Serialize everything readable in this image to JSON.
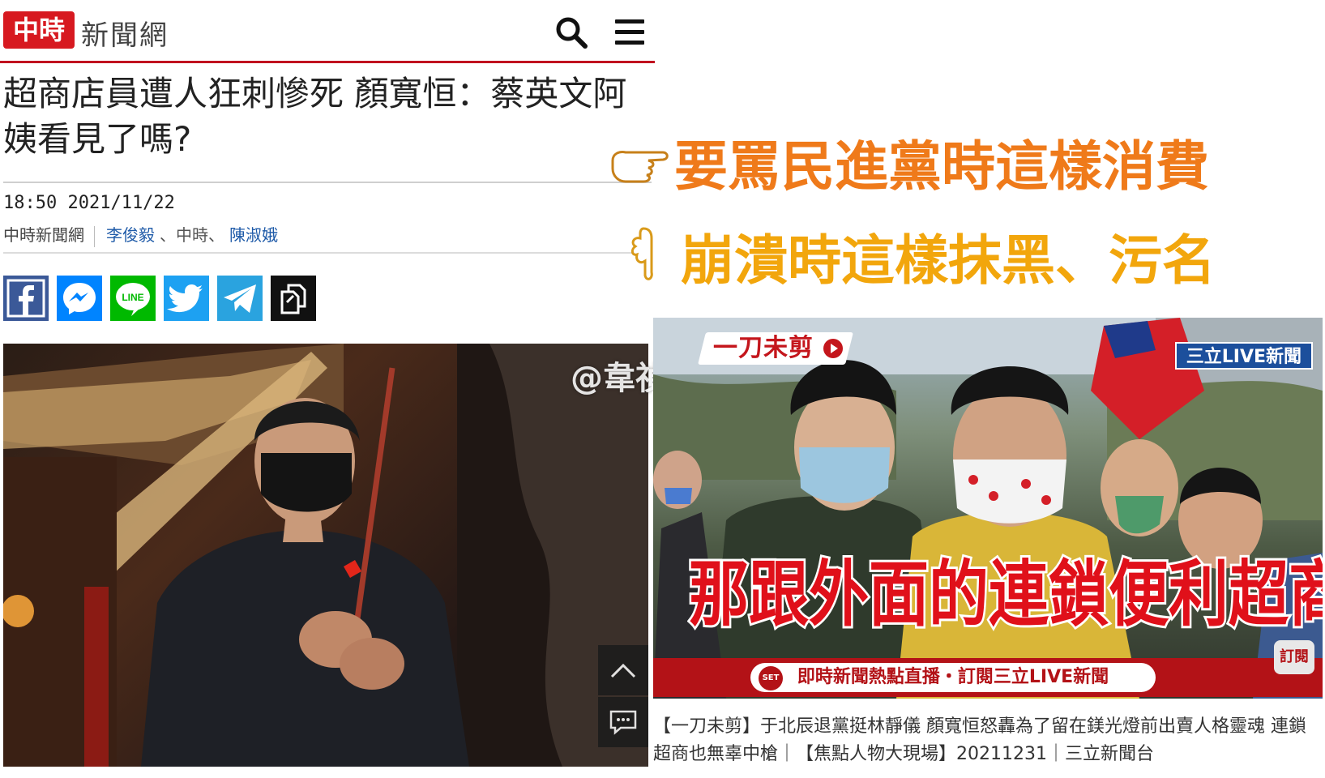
{
  "site": {
    "logo_mark": "中時",
    "logo_text": "新聞網",
    "search_icon": "search-icon",
    "menu_icon": "menu-icon"
  },
  "article": {
    "headline": "超商店員遭人狂刺慘死 顏寬恒：蔡英文阿姨看見了嗎?",
    "datetime": "18:50 2021/11/22",
    "source": "中時新聞網",
    "author1": "李俊毅",
    "sep1": "、中時、",
    "author2": "陳淑娥"
  },
  "share": [
    {
      "name": "facebook-share-icon",
      "color": "#3b5998"
    },
    {
      "name": "messenger-share-icon",
      "color": "#0084ff"
    },
    {
      "name": "line-share-icon",
      "color": "#00b900",
      "label": "LINE"
    },
    {
      "name": "twitter-share-icon",
      "color": "#1da1f2"
    },
    {
      "name": "telegram-share-icon",
      "color": "#2aa3df"
    },
    {
      "name": "copy-link-icon",
      "color": "#111111"
    }
  ],
  "photo": {
    "watermark": "@韋禎"
  },
  "callouts": {
    "line1": "要罵民進黨時這樣消費",
    "line2": "崩潰時這樣抹黑、污名"
  },
  "video": {
    "program_badge": "一刀未剪",
    "channel_badge": "三立LIVE新聞",
    "subtitle": "那跟外面的連鎖便利超商",
    "ticker_logo": "SET",
    "ticker": "即時新聞熱點直播・訂閱三立LIVE新聞",
    "subscribe": "訂閱",
    "caption": "【一刀未剪】于北辰退黨挺林靜儀 顏寬恒怒轟為了留在鎂光燈前出賣人格靈魂 連鎖超商也無辜中槍｜【焦點人物大現場】20211231｜三立新聞台"
  }
}
